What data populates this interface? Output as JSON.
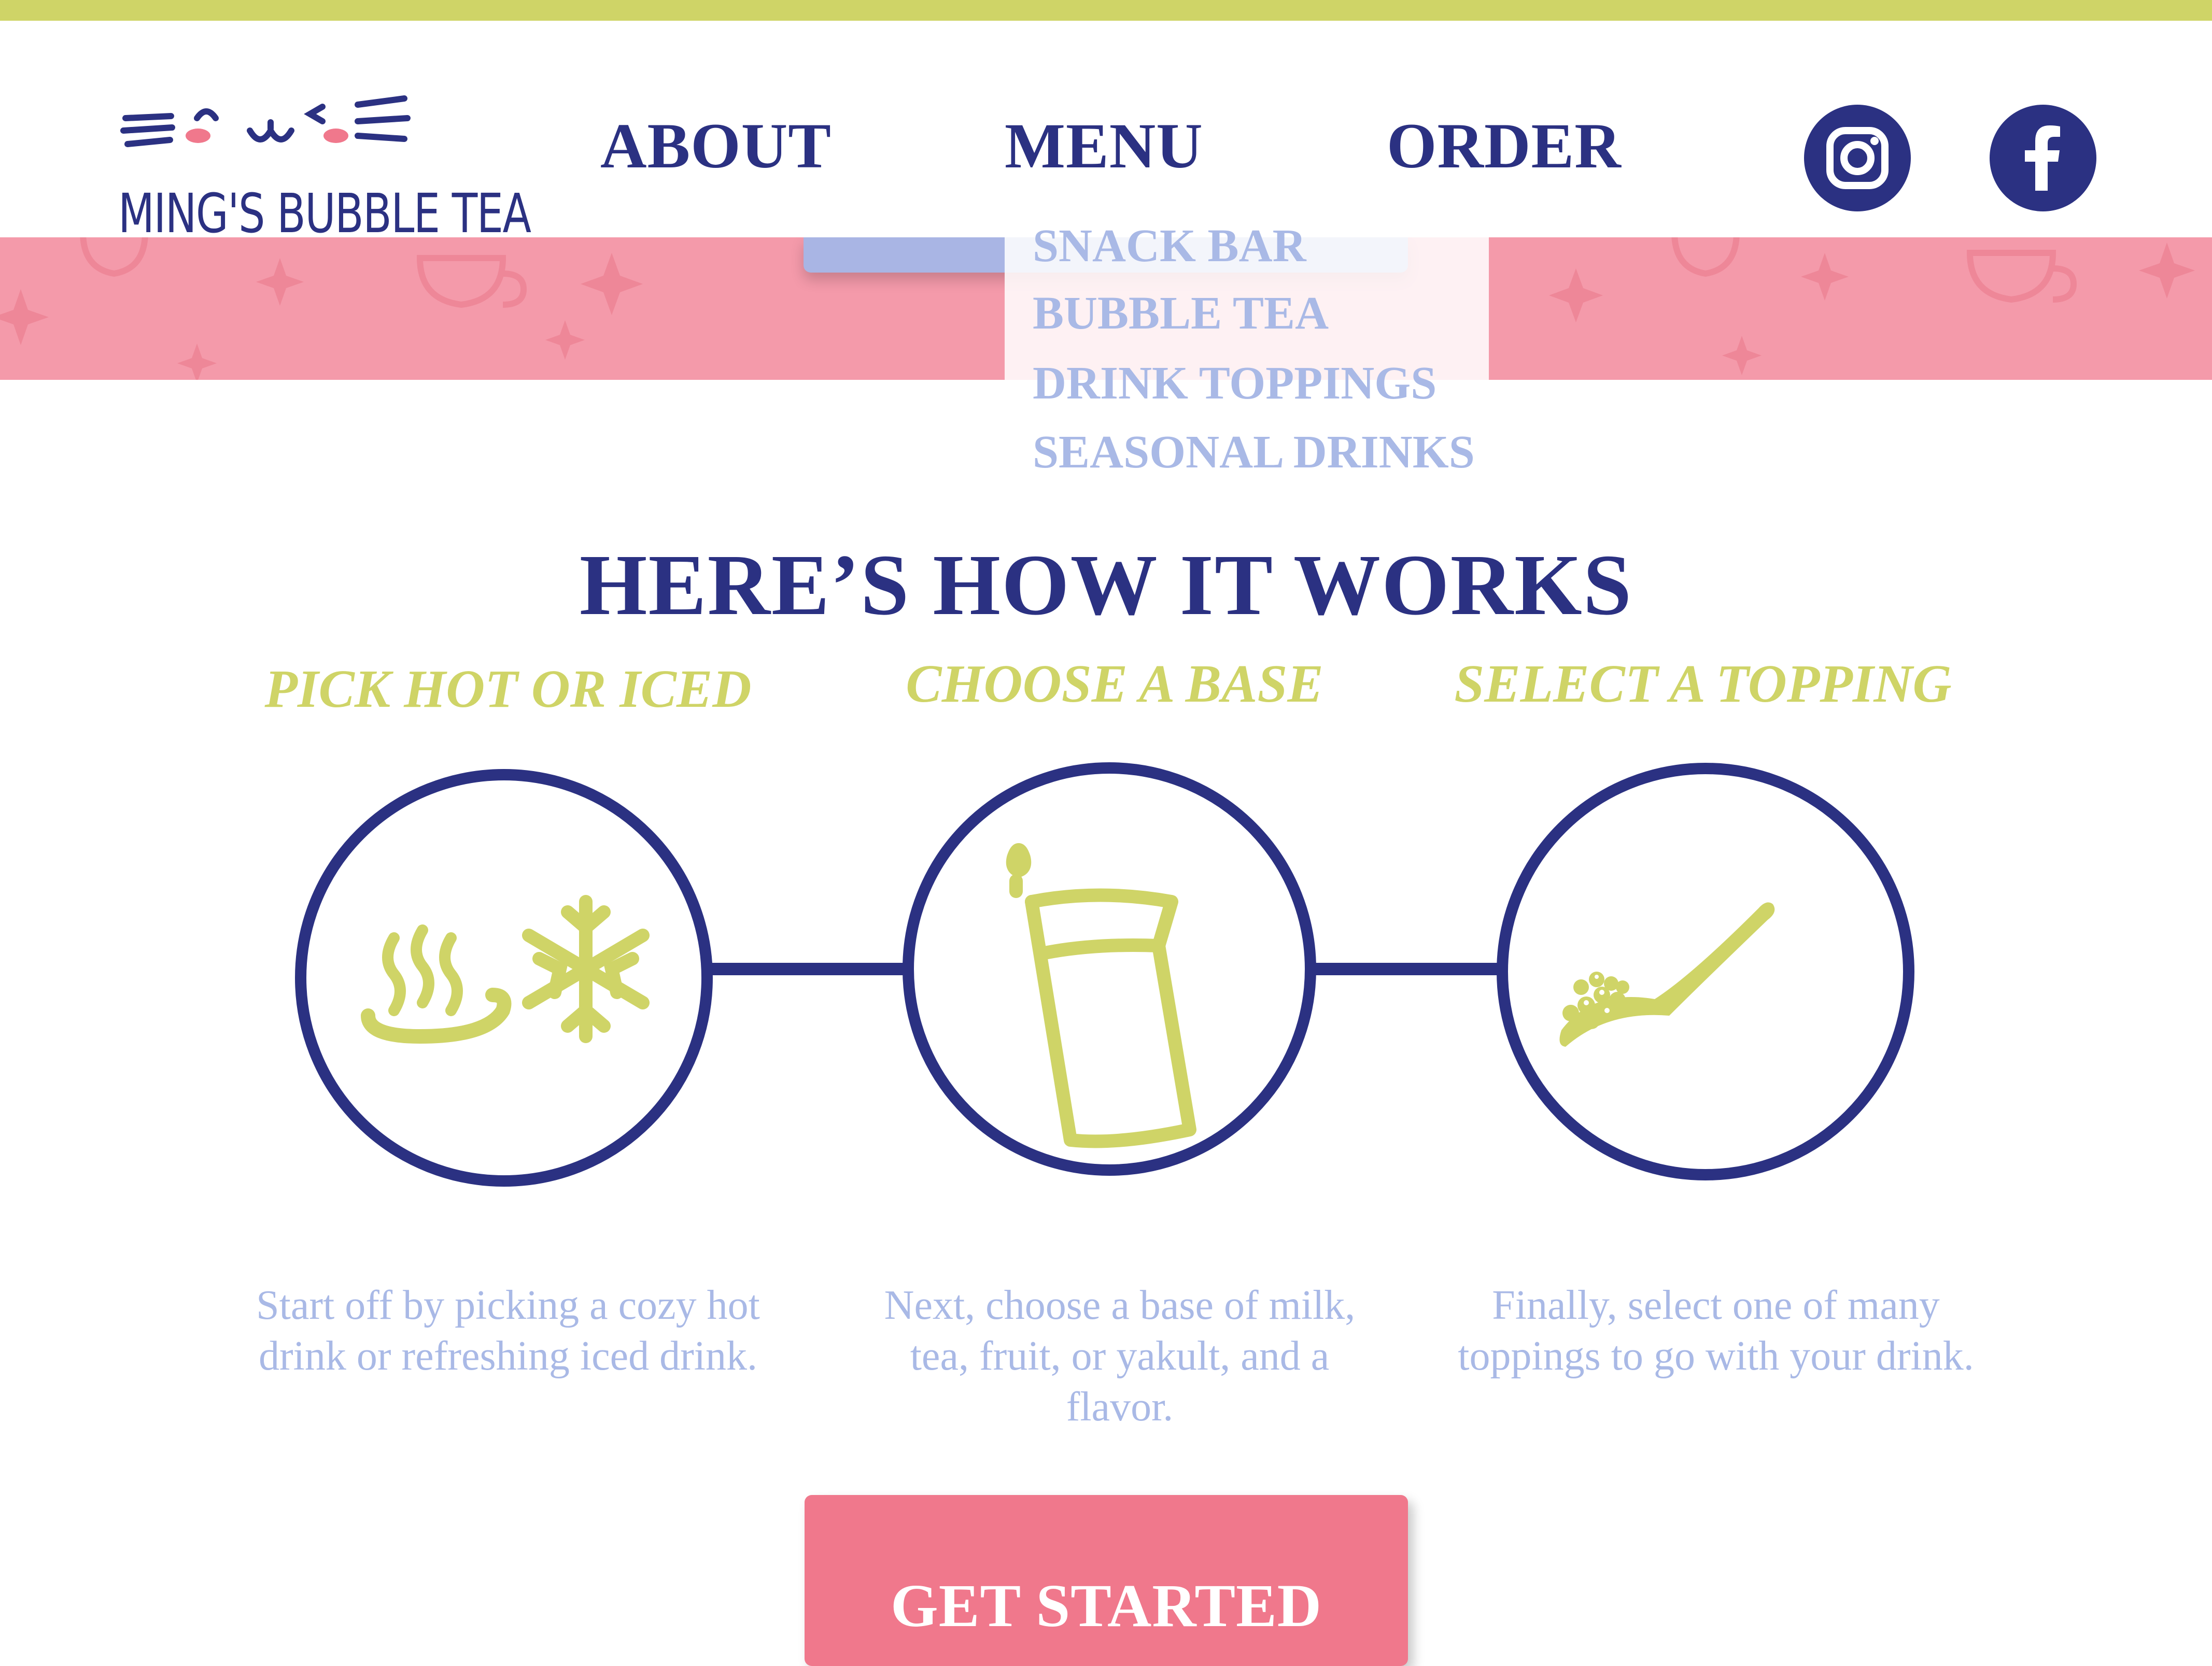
{
  "brand": {
    "name": "MING'S BUBBLE TEA",
    "logo_icon": "cat-face-icon"
  },
  "nav": {
    "about": "ABOUT",
    "menu": "MENU",
    "order": "ORDER"
  },
  "menu_dropdown": {
    "items": [
      "SNACK BAR",
      "BUBBLE TEA",
      "DRINK TOPPINGS",
      "SEASONAL DRINKS"
    ]
  },
  "social": {
    "instagram_icon": "instagram-icon",
    "facebook_icon": "facebook-icon"
  },
  "how_it_works": {
    "title": "HERE’S HOW IT WORKS",
    "steps": [
      {
        "heading": "PICK HOT OR ICED",
        "icon": "hot-and-iced-icon",
        "description": "Start off by picking a cozy hot drink or refreshing iced drink."
      },
      {
        "heading": "CHOOSE A BASE",
        "icon": "cup-icon",
        "description": "Next, choose a base of milk, tea, fruit, or yakult, and a flavor."
      },
      {
        "heading": "SELECT A TOPPING",
        "icon": "spoon-with-boba-icon",
        "description": "Finally, select one of many toppings to go with your drink."
      }
    ]
  },
  "cta": {
    "label": "GET STARTED"
  },
  "colors": {
    "navy": "#2b3182",
    "lime": "#cfd467",
    "pink_banner": "#f49aaa",
    "pink_button": "#f0788c",
    "periwinkle": "#a9b9e6"
  }
}
